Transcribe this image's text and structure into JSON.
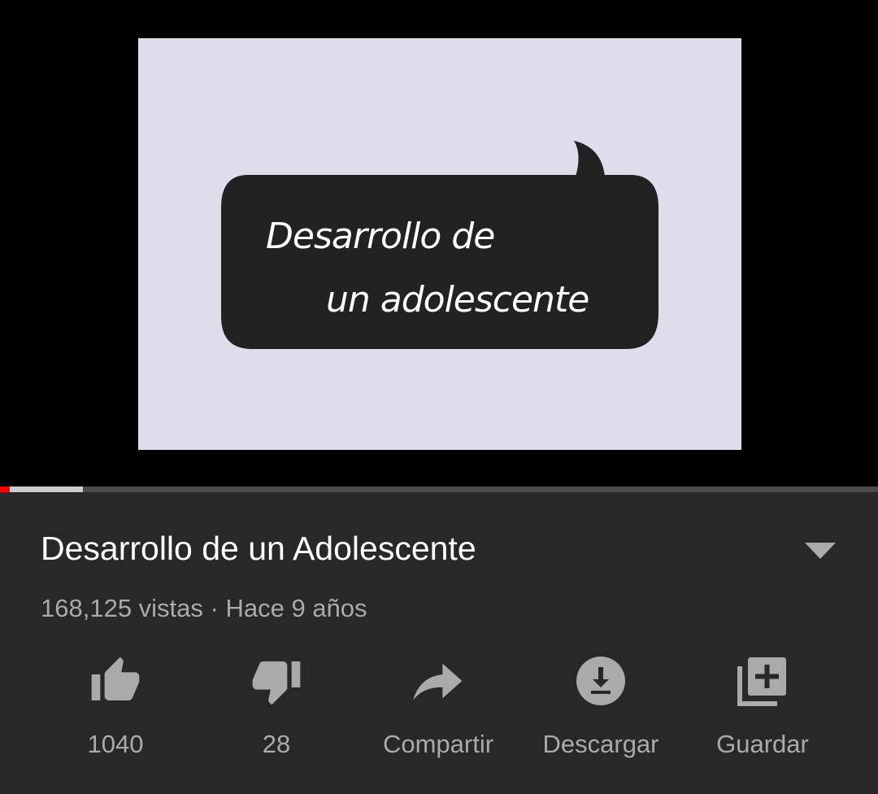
{
  "video": {
    "thumbnail_line1": "Desarrollo de",
    "thumbnail_line2": "un adolescente",
    "progress_fraction": 0.011,
    "buffered_fraction": 0.094
  },
  "info": {
    "title": "Desarrollo de un Adolescente",
    "meta": "168,125 vistas · Hace 9 años"
  },
  "actions": {
    "like": {
      "label": "1040",
      "icon": "thumbs-up-icon"
    },
    "dislike": {
      "label": "28",
      "icon": "thumbs-down-icon"
    },
    "share": {
      "label": "Compartir",
      "icon": "share-icon"
    },
    "download": {
      "label": "Descargar",
      "icon": "download-icon"
    },
    "save": {
      "label": "Guardar",
      "icon": "playlist-add-icon"
    }
  },
  "colors": {
    "background": "#282828",
    "player": "#000000",
    "thumbnail_bg": "#dfdcec",
    "progress_played": "#ff0000",
    "text_primary": "#ffffff",
    "text_secondary": "#aaaaaa"
  }
}
